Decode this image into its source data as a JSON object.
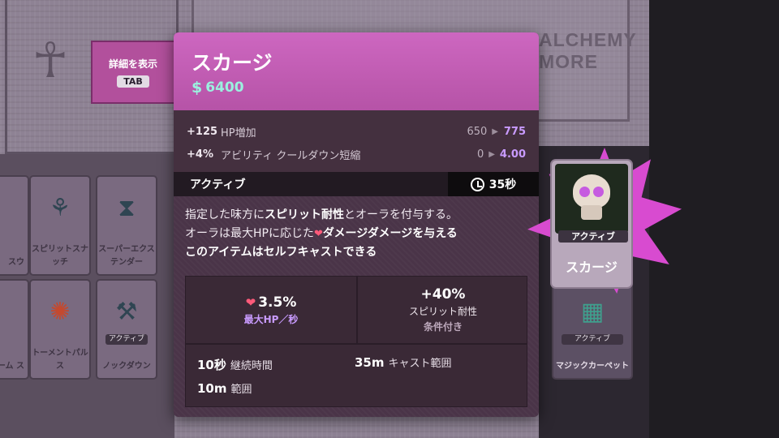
{
  "tab_hint": {
    "label": "詳細を表示",
    "key": "TAB"
  },
  "background": {
    "panel_text": "ALCHEMY MORE",
    "left_cards": [
      "スピリットスナッチ",
      "スーパーエクステンダー",
      "トーメントパルス",
      "ノックダウン"
    ],
    "left_card_tag": "アクティブ",
    "left_partial_cards": [
      "スウ",
      "ーム\nス"
    ],
    "right_card": {
      "tag": "アクティブ",
      "name": "マジックカーペット"
    }
  },
  "item": {
    "name": "スカージ",
    "cost": "6400",
    "stats": [
      {
        "bonus": "+125",
        "name": "HP増加",
        "from": "650",
        "to": "775"
      },
      {
        "bonus": "+4%",
        "name": "アビリティ クールダウン短縮",
        "from": "0",
        "to": "4.00"
      }
    ],
    "active_label": "アクティブ",
    "cooldown": "35秒",
    "description": {
      "line1_a": "指定した味方に",
      "line1_b": "スピリット耐性",
      "line1_c": "とオーラを付与する。",
      "line2_a": "オーラは最大HPに応じた",
      "line2_b": "ダメージダメージを与える",
      "line3": "このアイテムはセルフキャストできる"
    },
    "properties": {
      "main_left": {
        "value": "3.5%",
        "name": "最大HP／秒"
      },
      "main_right": {
        "value": "+40%",
        "name": "スピリット耐性",
        "condition": "条件付き"
      },
      "duration": {
        "value": "10秒",
        "name": "継続時間"
      },
      "cast_range": {
        "value": "35m",
        "name": "キャスト範囲"
      },
      "radius": {
        "value": "10m",
        "name": "範囲"
      }
    },
    "card_tag": "アクティブ",
    "icons": [
      "soul-icon",
      "clock-icon",
      "heart-icon",
      "skull-icon"
    ]
  },
  "colors": {
    "header": "#c25db5",
    "upgrade_value": "#c99bff",
    "souls": "#9bf0df",
    "star": "#d84bd0"
  }
}
